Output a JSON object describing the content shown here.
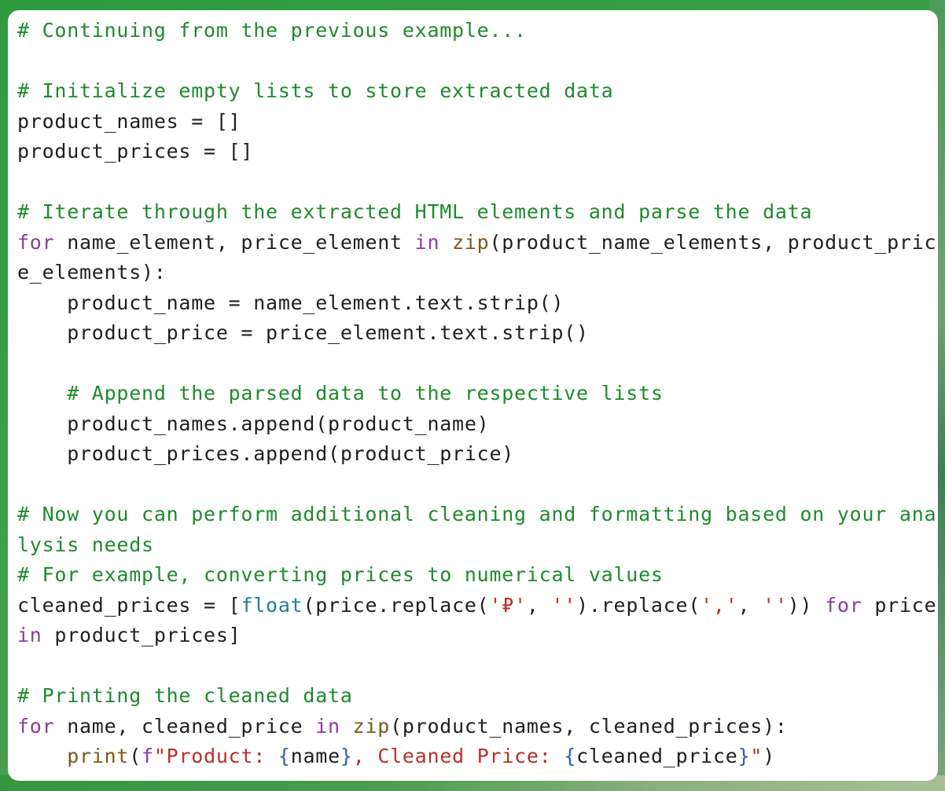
{
  "colors": {
    "background": "#3aa04a",
    "card": "#ffffff",
    "comment": "#1f8a2e",
    "keyword": "#8a3e9e",
    "builtin": "#7b5a1c",
    "type": "#1d7f9b",
    "string": "#b8302a",
    "brace": "#2f5fbf",
    "text": "#1f1f1f"
  },
  "code": {
    "language": "python",
    "lines": [
      [
        {
          "t": "comment",
          "v": "# Continuing from the previous example..."
        }
      ],
      [],
      [
        {
          "t": "comment",
          "v": "# Initialize empty lists to store extracted data"
        }
      ],
      [
        {
          "t": "plain",
          "v": "product_names = []"
        }
      ],
      [
        {
          "t": "plain",
          "v": "product_prices = []"
        }
      ],
      [],
      [
        {
          "t": "comment",
          "v": "# Iterate through the extracted HTML elements and parse the data"
        }
      ],
      [
        {
          "t": "kw",
          "v": "for"
        },
        {
          "t": "plain",
          "v": " name_element, price_element "
        },
        {
          "t": "kw",
          "v": "in"
        },
        {
          "t": "plain",
          "v": " "
        },
        {
          "t": "builtin",
          "v": "zip"
        },
        {
          "t": "plain",
          "v": "(product_name_elements, product_pric"
        }
      ],
      [
        {
          "t": "plain",
          "v": "e_elements):"
        }
      ],
      [
        {
          "t": "plain",
          "v": "    product_name = name_element.text.strip()"
        }
      ],
      [
        {
          "t": "plain",
          "v": "    product_price = price_element.text.strip()"
        }
      ],
      [],
      [
        {
          "t": "comment",
          "v": "    # Append the parsed data to the respective lists"
        }
      ],
      [
        {
          "t": "plain",
          "v": "    product_names.append(product_name)"
        }
      ],
      [
        {
          "t": "plain",
          "v": "    product_prices.append(product_price)"
        }
      ],
      [],
      [
        {
          "t": "comment",
          "v": "# Now you can perform additional cleaning and formatting based on your ana"
        }
      ],
      [
        {
          "t": "comment",
          "v": "lysis needs"
        }
      ],
      [
        {
          "t": "comment",
          "v": "# For example, converting prices to numerical values"
        }
      ],
      [
        {
          "t": "plain",
          "v": "cleaned_prices = ["
        },
        {
          "t": "type",
          "v": "float"
        },
        {
          "t": "plain",
          "v": "(price.replace("
        },
        {
          "t": "str",
          "v": "'₽'"
        },
        {
          "t": "plain",
          "v": ", "
        },
        {
          "t": "str",
          "v": "''"
        },
        {
          "t": "plain",
          "v": ").replace("
        },
        {
          "t": "str",
          "v": "','"
        },
        {
          "t": "plain",
          "v": ", "
        },
        {
          "t": "str",
          "v": "''"
        },
        {
          "t": "plain",
          "v": ")) "
        },
        {
          "t": "kw",
          "v": "for"
        },
        {
          "t": "plain",
          "v": " price"
        }
      ],
      [
        {
          "t": "kw",
          "v": "in"
        },
        {
          "t": "plain",
          "v": " product_prices]"
        }
      ],
      [],
      [
        {
          "t": "comment",
          "v": "# Printing the cleaned data"
        }
      ],
      [
        {
          "t": "kw",
          "v": "for"
        },
        {
          "t": "plain",
          "v": " name, cleaned_price "
        },
        {
          "t": "kw",
          "v": "in"
        },
        {
          "t": "plain",
          "v": " "
        },
        {
          "t": "builtin",
          "v": "zip"
        },
        {
          "t": "plain",
          "v": "(product_names, cleaned_prices):"
        }
      ],
      [
        {
          "t": "plain",
          "v": "    "
        },
        {
          "t": "builtin",
          "v": "print"
        },
        {
          "t": "plain",
          "v": "("
        },
        {
          "t": "kw",
          "v": "f"
        },
        {
          "t": "str",
          "v": "\"Product: "
        },
        {
          "t": "brace",
          "v": "{"
        },
        {
          "t": "plain",
          "v": "name"
        },
        {
          "t": "brace",
          "v": "}"
        },
        {
          "t": "str",
          "v": ", Cleaned Price: "
        },
        {
          "t": "brace",
          "v": "{"
        },
        {
          "t": "plain",
          "v": "cleaned_price"
        },
        {
          "t": "brace",
          "v": "}"
        },
        {
          "t": "str",
          "v": "\""
        },
        {
          "t": "plain",
          "v": ")"
        }
      ]
    ]
  }
}
